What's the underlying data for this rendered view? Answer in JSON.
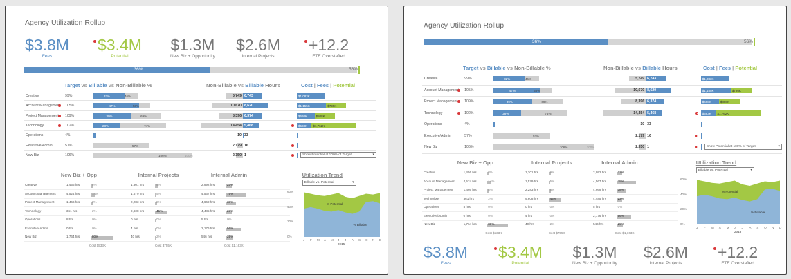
{
  "title": "Agency Utilization Rollup",
  "kpis": [
    {
      "value": "$3.8M",
      "label": "Fees",
      "color": "#5b8fc4",
      "dot": false
    },
    {
      "value": "$3.4M",
      "label": "Potential",
      "color": "#a3c844",
      "dot": true
    },
    {
      "value": "$1.3M",
      "label": "New Biz + Opportunity",
      "color": "#777777",
      "dot": false
    },
    {
      "value": "$2.6M",
      "label": "Internal Projects",
      "color": "#777777",
      "dot": false
    },
    {
      "value": "+12.2",
      "label": "FTE Overstaffed",
      "color": "#777777",
      "dot": true
    }
  ],
  "progress": {
    "value": 0.36,
    "label_left": "36%",
    "label_right": "56%",
    "target": 0.56
  },
  "headers": {
    "target_a": "Target",
    "vs1": "vs",
    "target_b": "Billable",
    "vs2": "vs",
    "target_c": "Non-Billable %",
    "hours_a": "Non-Billable",
    "hours_vs": "vs",
    "hours_b": "Billable",
    "hours_c": "Hours",
    "cost": "Cost",
    "sep1": "|",
    "fees": "Fees",
    "sep2": "|",
    "potential": "Potential"
  },
  "rows": [
    {
      "name": "Creative",
      "target": "99%",
      "flag": false,
      "billable": "32%",
      "billable_v": 0.32,
      "nonbill": "46%",
      "nonbill_v": 0.46,
      "nb_hours": "5,749",
      "b_hours": "6,743",
      "nb_h_v": 5749,
      "b_h_v": 6743,
      "cost": "$1,083K",
      "cost_v": 1083,
      "pot": "",
      "pot_v": 0,
      "dot3": false
    },
    {
      "name": "Account Management",
      "target": "105%",
      "flag": true,
      "billable": "47%",
      "billable_v": 0.47,
      "nonbill": "58%",
      "nonbill_v": 0.58,
      "nb_hours": "10,670",
      "b_hours": "8,620",
      "nb_h_v": 10670,
      "b_h_v": 8620,
      "cost": "$1,155K",
      "cost_v": 1155,
      "pot": "$795K",
      "pot_v": 795,
      "dot3": false
    },
    {
      "name": "Project Management",
      "target": "109%",
      "flag": true,
      "billable": "39%",
      "billable_v": 0.39,
      "nonbill": "69%",
      "nonbill_v": 0.69,
      "nb_hours": "8,396",
      "b_hours": "6,374",
      "nb_h_v": 8396,
      "b_h_v": 6374,
      "cost": "$698K",
      "cost_v": 698,
      "pot": "$808K",
      "pot_v": 808,
      "dot3": false
    },
    {
      "name": "Technology",
      "target": "102%",
      "flag": true,
      "billable": "28%",
      "billable_v": 0.28,
      "nonbill": "74%",
      "nonbill_v": 0.74,
      "nb_hours": "14,454",
      "b_hours": "5,468",
      "nb_h_v": 14454,
      "b_h_v": 5468,
      "cost": "$583K",
      "cost_v": 583,
      "pot": "$1,762K",
      "pot_v": 1762,
      "dot3": true
    },
    {
      "name": "Operations",
      "target": "4%",
      "flag": false,
      "billable": "",
      "billable_v": 0.03,
      "nonbill": "",
      "nonbill_v": 0.0,
      "nb_hours": "10",
      "b_hours": "33",
      "nb_h_v": 10,
      "b_h_v": 33,
      "cost": "",
      "cost_v": 20,
      "pot": "",
      "pot_v": 0,
      "dot3": false
    },
    {
      "name": "Executive/Admin",
      "target": "57%",
      "flag": false,
      "billable": "",
      "billable_v": 0.0,
      "nonbill": "57%",
      "nonbill_v": 0.57,
      "nb_hours": "2,179",
      "b_hours": "16",
      "nb_h_v": 2179,
      "b_h_v": 16,
      "cost": "",
      "cost_v": 8,
      "pot": "",
      "pot_v": 0,
      "dot3": true
    },
    {
      "name": "New Biz",
      "target": "106%",
      "flag": false,
      "billable": "",
      "billable_v": 0.0,
      "nonbill": "106%",
      "nonbill_v": 1.0,
      "nb_hours": "2,350",
      "b_hours": "1",
      "nb_h_v": 2350,
      "b_h_v": 1,
      "cost": "",
      "cost_v": 8,
      "pot": "",
      "pot_v": 0,
      "dot3": true,
      "tick": "100%"
    }
  ],
  "show_potential": "Show Potential at 100% of Target",
  "lower_headers": {
    "newbiz": "New Biz + Opp",
    "internal": "Internal Projects",
    "admin": "Internal Admin"
  },
  "lower_rows": [
    {
      "name": "Creative",
      "nb": "1,456 hrs",
      "nbp": "8%",
      "nbv": 0.08,
      "ip": "1,301 hrs",
      "ipp": "9%",
      "ipv": 0.09,
      "ia": "2,992 hrs",
      "iap": "23%",
      "iav": 0.23
    },
    {
      "name": "Account Management",
      "nb": "4,524 hrs",
      "nbp": "14%",
      "nbv": 0.14,
      "ip": "1,579 hrs",
      "ipp": "5%",
      "ipv": 0.05,
      "ia": "4,567 hrs",
      "iap": "75%",
      "iav": 0.75
    },
    {
      "name": "Project Management",
      "nb": "1,466 hrs",
      "nbp": "8%",
      "nbv": 0.08,
      "ip": "2,283 hrs",
      "ipp": "8%",
      "ipv": 0.08,
      "ia": "4,669 hrs",
      "iap": "38%",
      "iav": 0.38
    },
    {
      "name": "Technology",
      "nb": "361 hrs",
      "nbp": "2%",
      "nbv": 0.02,
      "ip": "9,608 hrs",
      "ipp": "45%",
      "ipv": 0.45,
      "ia": "4,485 hrs",
      "iap": "23%",
      "iav": 0.23
    },
    {
      "name": "Operations",
      "nb": "8 hrs",
      "nbp": "0%",
      "nbv": 0.0,
      "ip": "0 hrs",
      "ipp": "0%",
      "ipv": 0.0,
      "ia": "5 hrs",
      "iap": "0%",
      "iav": 0.0
    },
    {
      "name": "Executive/Admin",
      "nb": "0 hrs",
      "nbp": "0%",
      "nbv": 0.0,
      "ip": "4 hrs",
      "ipp": "0%",
      "ipv": 0.0,
      "ia": "2,176 hrs",
      "iap": "56%",
      "iav": 0.56
    },
    {
      "name": "New Biz",
      "nb": "1,764 hrs",
      "nbp": "80%",
      "nbv": 0.8,
      "ip": "40 hrs",
      "ipp": "2%",
      "ipv": 0.02,
      "ia": "546 hrs",
      "iap": "25%",
      "iav": 0.25
    }
  ],
  "lower_costs": {
    "newbiz": "Cost  $533K",
    "internal": "Cost  $755K",
    "admin": "Cost  $1,163K"
  },
  "trend": {
    "title": "Utilization Trend",
    "select": "Billable vs. Potential",
    "label_potential": "% Potential",
    "label_billable": "% Billable"
  },
  "chart_data": {
    "type": "area",
    "title": "Utilization Trend",
    "x": [
      "J",
      "F",
      "M",
      "A",
      "M",
      "J",
      "J",
      "A",
      "S",
      "O",
      "N",
      "D"
    ],
    "xlabel": "2015",
    "yticks": [
      "0%",
      "20%",
      "40%",
      "60%"
    ],
    "ylim": [
      0,
      65
    ],
    "series": [
      {
        "name": "% Potential",
        "values": [
          60,
          58,
          56,
          55,
          57,
          59,
          54,
          52,
          55,
          58,
          57,
          59
        ]
      },
      {
        "name": "% Billable",
        "values": [
          38,
          40,
          38,
          35,
          34,
          36,
          33,
          31,
          34,
          47,
          48,
          45
        ]
      }
    ]
  },
  "colors": {
    "blue": "#5b8fc4",
    "green": "#a3c844",
    "red": "#d9383a",
    "gray": "#cfcfcf"
  }
}
